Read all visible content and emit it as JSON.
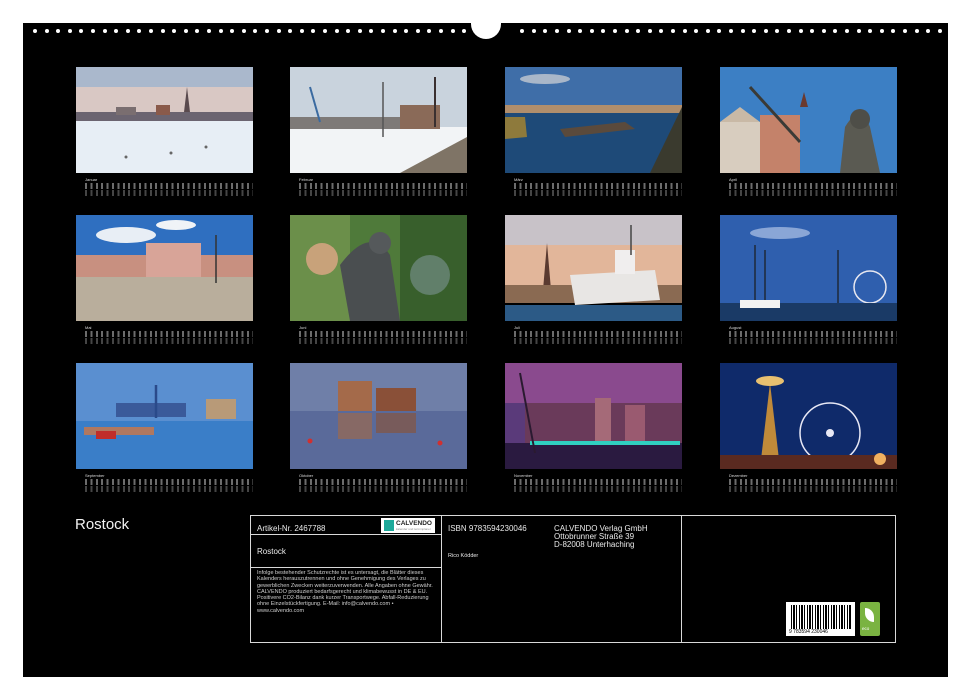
{
  "calendar_title": "Rostock",
  "months": [
    {
      "label": "Januar",
      "photo": "winter-harbor-skyline"
    },
    {
      "label": "Februar",
      "photo": "snowy-quay-sailing-ship"
    },
    {
      "label": "März",
      "photo": "river-warnow-skyline"
    },
    {
      "label": "April",
      "photo": "neptune-statue-gables"
    },
    {
      "label": "Mai",
      "photo": "neuer-markt-townhall"
    },
    {
      "label": "Juni",
      "photo": "fountain-bronze-figure"
    },
    {
      "label": "Juli",
      "photo": "museum-ship-harbor"
    },
    {
      "label": "August",
      "photo": "tall-ships-ferris-wheel"
    },
    {
      "label": "September",
      "photo": "harbor-crane-boats"
    },
    {
      "label": "Oktober",
      "photo": "warehouses-reflection"
    },
    {
      "label": "November",
      "photo": "christmas-market-dusk"
    },
    {
      "label": "Dezember",
      "photo": "christmas-pyramid-wheel"
    }
  ],
  "info": {
    "article": "Artikel-Nr. 2467788",
    "product_title": "Rostock",
    "legal": "Infolge bestehender Schutzrechte ist es untersagt, die Blätter dieses Kalenders herauszutrennen und ohne Genehmigung des Verlages zu gewerblichen Zwecken weiterzuverwenden. Alle Angaben ohne Gewähr. CALVENDO produziert bedarfsgerecht und klimabewusst in DE & EU. Positivere CO2-Bilanz dank kurzer Transportwege. Abfall-Reduzierung ohne Einzelstückfertigung. E-Mail: info@calvendo.com • www.calvendo.com",
    "isbn": "ISBN 9783594230046",
    "author": "Rico Ködder",
    "publisher_name": "CALVENDO Verlag GmbH",
    "publisher_street": "Ottobrunner Straße 39",
    "publisher_city": "D-82008 Unterhaching",
    "logo_text": "CALVENDO",
    "logo_sub": "kalender und terminplaner",
    "barcode_number": "9 783594 230046",
    "eco_label": "eco"
  },
  "colors": {
    "sheet": "#000000",
    "page": "#ffffff",
    "logo_accent": "#1ea99a",
    "eco_green": "#7ab341"
  }
}
